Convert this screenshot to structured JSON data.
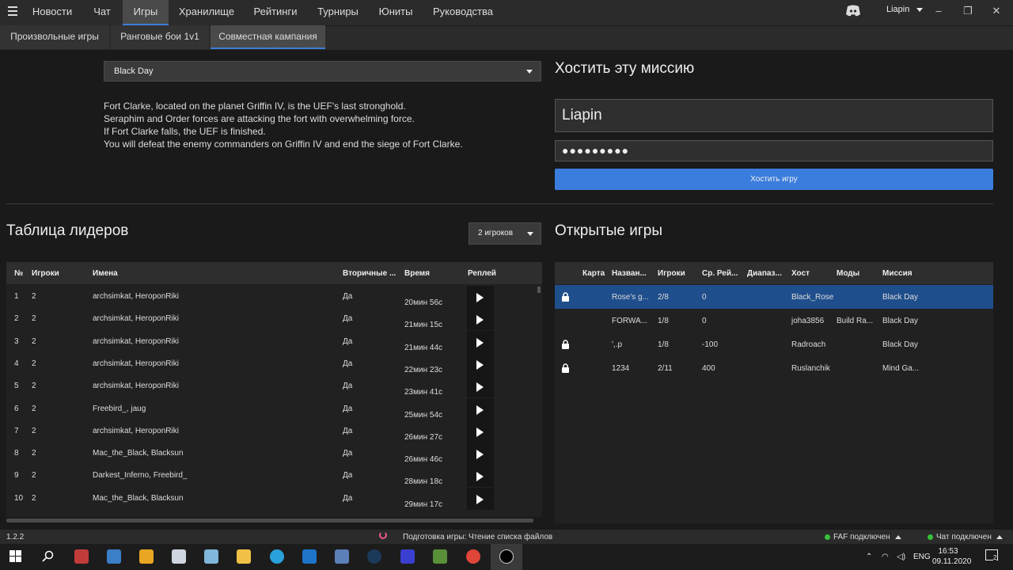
{
  "nav": {
    "tabs": [
      "Новости",
      "Чат",
      "Игры",
      "Хранилище",
      "Рейтинги",
      "Турниры",
      "Юниты",
      "Руководства"
    ],
    "active_index": 2,
    "user": "Liapin"
  },
  "subtabs": {
    "items": [
      "Произвольные игры",
      "Ранговые бои 1v1",
      "Совместная кампания"
    ],
    "active_index": 2
  },
  "mission": {
    "selected": "Black Day",
    "description": [
      "Fort Clarke, located on the planet Griffin IV, is the UEF's last stronghold.",
      "Seraphim and Order forces are attacking the fort with overwhelming force.",
      "If Fort Clarke falls, the UEF is finished.",
      "You will defeat the enemy commanders on Griffin IV and end the siege of Fort Clarke."
    ]
  },
  "host": {
    "title": "Хостить эту миссию",
    "game_name": "Liapin",
    "password": "●●●●●●●●●",
    "button": "Хостить игру"
  },
  "leaderboard": {
    "title": "Таблица лидеров",
    "players_filter": "2 игроков",
    "headers": [
      "№",
      "Игроки",
      "Имена",
      "Вторичные ...",
      "Время",
      "Реплей"
    ],
    "rows": [
      {
        "n": "1",
        "players": "2",
        "names": "archsimkat, HeroponRiki",
        "secondary": "Да",
        "time": "20мин 56с"
      },
      {
        "n": "2",
        "players": "2",
        "names": "archsimkat, HeroponRiki",
        "secondary": "Да",
        "time": "21мин 15с"
      },
      {
        "n": "3",
        "players": "2",
        "names": "archsimkat, HeroponRiki",
        "secondary": "Да",
        "time": "21мин 44с"
      },
      {
        "n": "4",
        "players": "2",
        "names": "archsimkat, HeroponRiki",
        "secondary": "Да",
        "time": "22мин 23с"
      },
      {
        "n": "5",
        "players": "2",
        "names": "archsimkat, HeroponRiki",
        "secondary": "Да",
        "time": "23мин 41с"
      },
      {
        "n": "6",
        "players": "2",
        "names": "Freebird_, jaug",
        "secondary": "Да",
        "time": "25мин 54с"
      },
      {
        "n": "7",
        "players": "2",
        "names": "archsimkat, HeroponRiki",
        "secondary": "Да",
        "time": "26мин 27с"
      },
      {
        "n": "8",
        "players": "2",
        "names": "Mac_the_Black, Blacksun",
        "secondary": "Да",
        "time": "26мин 46с"
      },
      {
        "n": "9",
        "players": "2",
        "names": "Darkest_Inferno, Freebird_",
        "secondary": "Да",
        "time": "28мин 18с"
      },
      {
        "n": "10",
        "players": "2",
        "names": "Mac_the_Black, Blacksun",
        "secondary": "Да",
        "time": "29мин 17с"
      }
    ]
  },
  "open_games": {
    "title": "Открытые игры",
    "headers": [
      "Карта",
      "Назван...",
      "Игроки",
      "Ср. Рей...",
      "Диапаз...",
      "Хост",
      "Моды",
      "Миссия"
    ],
    "rows": [
      {
        "locked": true,
        "name": "Rose's g...",
        "players": "2/8",
        "rating": "0",
        "host": "Black_Rose",
        "mods": "",
        "mission": "Black Day",
        "selected": true
      },
      {
        "locked": false,
        "name": "FORWA...",
        "players": "1/8",
        "rating": "0",
        "host": "joha3856",
        "mods": "Build Ra...",
        "mission": "Black Day",
        "selected": false
      },
      {
        "locked": true,
        "name": "',.р",
        "players": "1/8",
        "rating": "-100",
        "host": "Radroach",
        "mods": "",
        "mission": "Black Day",
        "selected": false
      },
      {
        "locked": true,
        "name": "1234",
        "players": "2/11",
        "rating": "400",
        "host": "Ruslanchik",
        "mods": "",
        "mission": "Mind Ga...",
        "selected": false
      }
    ]
  },
  "status": {
    "version": "1.2.2",
    "message": "Подготовка игры: Чтение списка файлов",
    "faf": "FAF подключен",
    "chat": "Чат подключен"
  },
  "taskbar": {
    "lang": "ENG",
    "time": "16:53",
    "date": "09.11.2020",
    "notifications": "2"
  },
  "colors": {
    "accent": "#3d7fd6",
    "host_button": "#3b7ddd",
    "selected_row": "#1f4e8c",
    "connected": "#38c13a"
  }
}
